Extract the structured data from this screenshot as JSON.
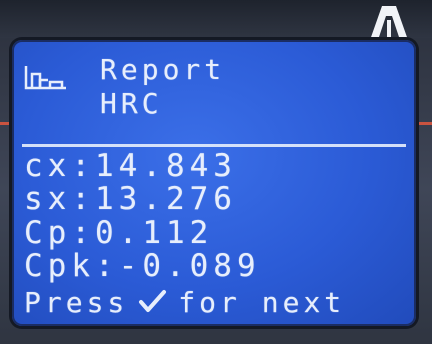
{
  "screen": {
    "title": "Report",
    "subtitle": "HRC",
    "report_icon": "report-icon"
  },
  "stats": [
    {
      "label": "cx",
      "value": "14.843"
    },
    {
      "label": "sx",
      "value": "13.276"
    },
    {
      "label": "Cp",
      "value": "0.112"
    },
    {
      "label": "Cpk",
      "value": "-0.089"
    }
  ],
  "stat_lines": [
    "cx:14.843",
    "sx:13.276",
    "Cp:0.112",
    "Cpk:-0.089"
  ],
  "prompt": {
    "before": "Press",
    "icon": "check-icon",
    "after": "for next"
  },
  "colors": {
    "lcd_background": "#2b5bd6",
    "lcd_text": "#e7eefc",
    "bezel": "#2f3542",
    "accent_red": "#d9553f"
  }
}
